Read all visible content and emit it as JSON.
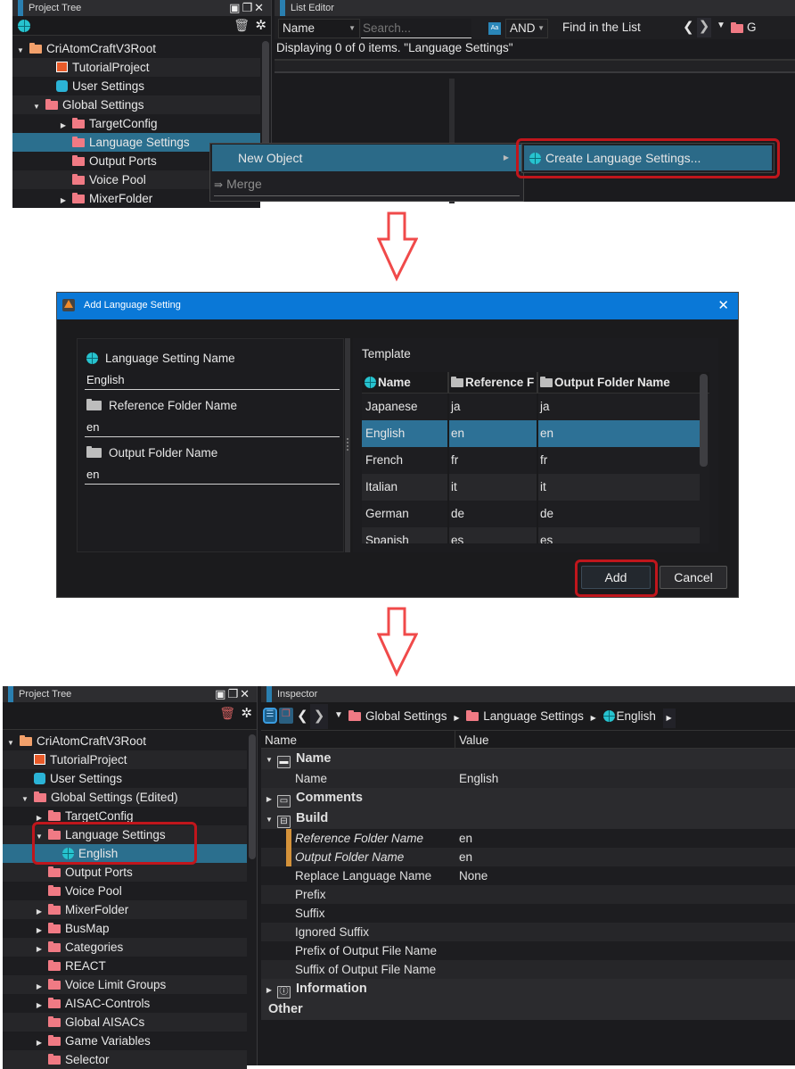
{
  "step1": {
    "project_tree": {
      "title": "Project Tree",
      "items": [
        {
          "label": "CriAtomCraftV3Root",
          "icon": "folder-root-icon",
          "expander": "expanded"
        },
        {
          "label": "TutorialProject",
          "icon": "project-icon",
          "expander": "none"
        },
        {
          "label": "User Settings",
          "icon": "user-icon",
          "expander": "none"
        },
        {
          "label": "Global Settings",
          "icon": "folder-open-icon",
          "expander": "expanded"
        },
        {
          "label": "TargetConfig",
          "icon": "folder-icon",
          "expander": "collapsed"
        },
        {
          "label": "Language Settings",
          "icon": "folder-icon",
          "expander": "none",
          "selected": true
        },
        {
          "label": "Output Ports",
          "icon": "folder-icon",
          "expander": "none"
        },
        {
          "label": "Voice Pool",
          "icon": "folder-icon",
          "expander": "none"
        },
        {
          "label": "MixerFolder",
          "icon": "folder-icon",
          "expander": "collapsed"
        }
      ]
    },
    "list_editor": {
      "title": "List Editor",
      "column_select": "Name",
      "search_placeholder": "Search...",
      "case_toggle": "Aa",
      "logic_select": "AND",
      "find_label": "Find in the List",
      "breadcrumb_partial": "G",
      "status": "Displaying 0 of 0 items. \"Language Settings\""
    },
    "context_menu": {
      "items": [
        {
          "label": "New Object",
          "has_submenu": true,
          "highlighted": true
        },
        {
          "label": "Merge",
          "disabled": true,
          "icon": "merge-icon"
        }
      ],
      "submenu": [
        {
          "label": "Create Language Settings...",
          "icon": "globe-icon",
          "highlighted": true
        }
      ]
    }
  },
  "dialog": {
    "title": "Add Language Setting",
    "fields": [
      {
        "label": "Language Setting Name",
        "icon": "globe-icon",
        "value": "English"
      },
      {
        "label": "Reference Folder Name",
        "icon": "folder-icon",
        "value": "en"
      },
      {
        "label": "Output Folder Name",
        "icon": "folder-icon",
        "value": "en"
      }
    ],
    "template": {
      "label": "Template",
      "columns": [
        "Name",
        "Reference F",
        "Output Folder Name"
      ],
      "rows": [
        [
          "Japanese",
          "ja",
          "ja"
        ],
        [
          "English",
          "en",
          "en"
        ],
        [
          "French",
          "fr",
          "fr"
        ],
        [
          "Italian",
          "it",
          "it"
        ],
        [
          "German",
          "de",
          "de"
        ],
        [
          "Spanish",
          "es",
          "es"
        ]
      ],
      "selected_index": 1
    },
    "add_label": "Add",
    "cancel_label": "Cancel"
  },
  "step3": {
    "project_tree": {
      "title": "Project Tree",
      "items": [
        {
          "label": "CriAtomCraftV3Root",
          "icon": "folder-root-icon",
          "expander": "expanded",
          "level": 0
        },
        {
          "label": "TutorialProject",
          "icon": "project-icon",
          "expander": "none",
          "level": 1
        },
        {
          "label": "User Settings",
          "icon": "user-icon",
          "expander": "none",
          "level": 1
        },
        {
          "label": "Global Settings (Edited)",
          "icon": "folder-open-icon",
          "expander": "expanded",
          "level": 1
        },
        {
          "label": "TargetConfig",
          "icon": "folder-icon",
          "expander": "collapsed",
          "level": 2
        },
        {
          "label": "Language Settings",
          "icon": "folder-open-icon",
          "expander": "expanded",
          "level": 2
        },
        {
          "label": "English",
          "icon": "globe-icon",
          "expander": "none",
          "level": 3,
          "selected": true
        },
        {
          "label": "Output Ports",
          "icon": "folder-icon",
          "expander": "none",
          "level": 2
        },
        {
          "label": "Voice Pool",
          "icon": "folder-icon",
          "expander": "none",
          "level": 2
        },
        {
          "label": "MixerFolder",
          "icon": "folder-icon",
          "expander": "collapsed",
          "level": 2
        },
        {
          "label": "BusMap",
          "icon": "folder-icon",
          "expander": "collapsed",
          "level": 2
        },
        {
          "label": "Categories",
          "icon": "folder-icon",
          "expander": "collapsed",
          "level": 2
        },
        {
          "label": "REACT",
          "icon": "folder-icon",
          "expander": "none",
          "level": 2
        },
        {
          "label": "Voice Limit Groups",
          "icon": "folder-icon",
          "expander": "collapsed",
          "level": 2
        },
        {
          "label": "AISAC-Controls",
          "icon": "folder-icon",
          "expander": "collapsed",
          "level": 2
        },
        {
          "label": "Global AISACs",
          "icon": "folder-icon",
          "expander": "none",
          "level": 2
        },
        {
          "label": "Game Variables",
          "icon": "folder-icon",
          "expander": "collapsed",
          "level": 2
        },
        {
          "label": "Selector",
          "icon": "folder-icon",
          "expander": "none",
          "level": 2
        }
      ]
    },
    "inspector": {
      "title": "Inspector",
      "breadcrumb": [
        "Global Settings",
        "Language Settings",
        "English"
      ],
      "columns": [
        "Name",
        "Value"
      ],
      "rows": [
        {
          "type": "group",
          "label": "Name",
          "icon": "name-icon",
          "expander": "expanded"
        },
        {
          "type": "prop",
          "label": "Name",
          "value": "English"
        },
        {
          "type": "group",
          "label": "Comments",
          "icon": "comments-icon",
          "expander": "collapsed"
        },
        {
          "type": "group",
          "label": "Build",
          "icon": "build-icon",
          "expander": "expanded"
        },
        {
          "type": "prop",
          "label": "Reference Folder Name",
          "value": "en",
          "modified": true
        },
        {
          "type": "prop",
          "label": "Output Folder Name",
          "value": "en",
          "modified": true
        },
        {
          "type": "prop",
          "label": "Replace Language Name",
          "value": "None"
        },
        {
          "type": "prop",
          "label": "Prefix",
          "value": ""
        },
        {
          "type": "prop",
          "label": "Suffix",
          "value": ""
        },
        {
          "type": "prop",
          "label": "Ignored Suffix",
          "value": ""
        },
        {
          "type": "prop",
          "label": "Prefix of Output File Name",
          "value": ""
        },
        {
          "type": "prop",
          "label": "Suffix of Output File Name",
          "value": ""
        },
        {
          "type": "group",
          "label": "Information",
          "icon": "info-icon",
          "expander": "collapsed"
        },
        {
          "type": "group",
          "label": "Other",
          "icon": "",
          "expander": "none"
        }
      ]
    }
  },
  "colors": {
    "selection": "#2b6f8e",
    "highlight_box": "#c0161c",
    "dialog_titlebar": "#0a78d7",
    "arrow": "#f04a4a",
    "modified_marker": "#d4923a"
  }
}
